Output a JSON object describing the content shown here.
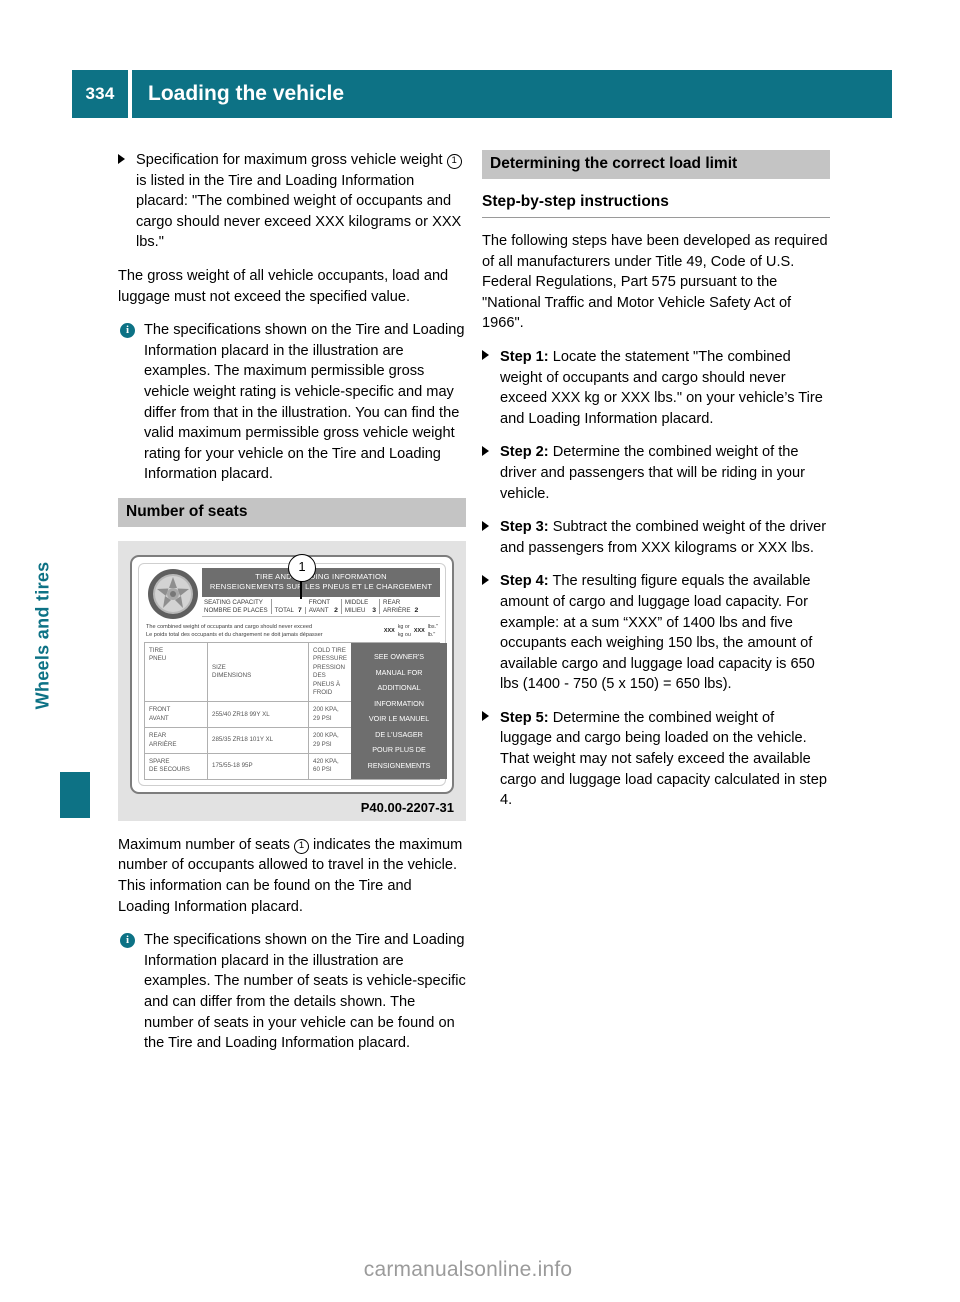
{
  "header": {
    "page_number": "334",
    "title": "Loading the vehicle"
  },
  "side_tab": {
    "chapter_label": "Wheels and tires"
  },
  "left_column": {
    "bullet_1": {
      "text_a": "Specification for maximum gross vehicle weight ",
      "ref": "1",
      "text_b": " is listed in the Tire and Loading Information placard: \"The combined weight of occupants and cargo should never exceed XXX kilograms or XXX lbs.\""
    },
    "paragraph_1": "The gross weight of all vehicle occupants, load and luggage must not exceed the specified value.",
    "note_1": {
      "icon": "info-icon",
      "text": "The specifications shown on the Tire and Loading Information placard in the illustration are examples. The maximum permissible gross vehicle weight rating is vehicle-specific and may differ from that in the illustration. You can find the valid maximum permissible gross vehicle weight rating for your vehicle on the Tire and Loading Information placard."
    },
    "section_heading": "Number of seats",
    "figure": {
      "callout_number": "1",
      "banner_line_1": "TIRE AND LOADING INFORMATION",
      "banner_line_2": "RENSEIGNEMENTS SUR LES PNEUS ET LE CHARGEMENT",
      "seating": {
        "caption_en": "SEATING CAPACITY",
        "caption_fr": "NOMBRE DE PLACES",
        "fields": [
          {
            "label": "TOTAL",
            "value": "7"
          },
          {
            "label_en": "FRONT",
            "label_fr": "AVANT",
            "value": "2"
          },
          {
            "label_en": "MIDDLE",
            "label_fr": "MILIEU",
            "value": "3"
          },
          {
            "label_en": "REAR",
            "label_fr": "ARRIÈRE",
            "value": "2"
          }
        ]
      },
      "combined": {
        "line_en": "The combined weight of occupants and cargo should never exceed",
        "line_fr": "Le poids total des occupants et du chargement ne doit jamais dépasser",
        "value_kg": "XXX",
        "unit_kg_en": "kg or",
        "unit_kg_fr": "kg ou",
        "value_lb": "XXX",
        "unit_lb_en": "lbs.\"",
        "unit_lb_fr": "lb.\""
      },
      "table": {
        "header": {
          "c1_en": "TIRE",
          "c1_fr": "PNEU",
          "c2_en": "SIZE",
          "c2_fr": "DIMENSIONS",
          "c3_l1": "COLD TIRE PRESSURE",
          "c3_l2": "PRESSION DES",
          "c3_l3": "PNEUS À FROID"
        },
        "rows": [
          {
            "c1_en": "FRONT",
            "c1_fr": "AVANT",
            "size": "255/40 ZR18 99Y XL",
            "pressure": "200 KPA, 29 PSI"
          },
          {
            "c1_en": "REAR",
            "c1_fr": "ARRIÈRE",
            "size": "285/35 ZR18 101Y XL",
            "pressure": "200 KPA, 29 PSI"
          },
          {
            "c1_en": "SPARE",
            "c1_fr": "DE SECOURS",
            "size": "175/55-18 95P",
            "pressure": "420 KPA, 60 PSI"
          }
        ],
        "side_panel_en": [
          "SEE OWNER'S",
          "MANUAL FOR",
          "ADDITIONAL",
          "INFORMATION"
        ],
        "side_panel_fr": [
          "VOIR LE MANUEL",
          "DE L'USAGER",
          "POUR PLUS DE",
          "RENSIGNEMENTS"
        ]
      },
      "caption": "P40.00-2207-31"
    },
    "paragraph_2": {
      "text_a": "Maximum number of seats ",
      "ref": "1",
      "text_b": " indicates the maximum number of occupants allowed to travel in the vehicle. This information can be found on the Tire and Loading Information placard."
    },
    "note_2": {
      "icon": "info-icon",
      "text": "The specifications shown on the Tire and Loading Information placard in the illustration are examples. The number of seats is vehicle-specific and can differ from the details shown. The number of seats in your vehicle can be found on the Tire and Loading Information placard."
    }
  },
  "right_column": {
    "section_heading": "Determining the correct load limit",
    "sub_heading": "Step-by-step instructions",
    "intro": "The following steps have been developed as required of all manufacturers under Title 49, Code of U.S. Federal Regulations, Part 575 pursuant to the \"National Traffic and Motor Vehicle Safety Act of 1966\".",
    "steps": [
      {
        "label": "Step 1:",
        "text": " Locate the statement \"The combined weight of occupants and cargo should never exceed XXX kg or XXX lbs.\" on your vehicle’s Tire and Loading Information placard."
      },
      {
        "label": "Step 2:",
        "text": " Determine the combined weight of the driver and passengers that will be riding in your vehicle."
      },
      {
        "label": "Step 3:",
        "text": " Subtract the combined weight of the driver and passengers from XXX kilograms or XXX lbs."
      },
      {
        "label": "Step 4:",
        "text": " The resulting figure equals the available amount of cargo and luggage load capacity. For example: at a sum “XXX” of 1400 lbs and five occupants each weighing 150 lbs, the amount of available cargo and luggage load capacity is 650 lbs (1400 - 750 (5 x 150) = 650 lbs)."
      },
      {
        "label": "Step 5:",
        "text": " Determine the combined weight of luggage and cargo being loaded on the vehicle. That weight may not safely exceed the available cargo and luggage load capacity calculated in step 4."
      }
    ]
  },
  "footer": {
    "watermark": "carmanualsonline.info"
  },
  "colors": {
    "accent_teal": "#0d7285",
    "section_bar_gray": "#c4c4c4",
    "figure_bg_gray": "#e2e2e2",
    "placard_panel_gray": "#6e6e6e"
  }
}
